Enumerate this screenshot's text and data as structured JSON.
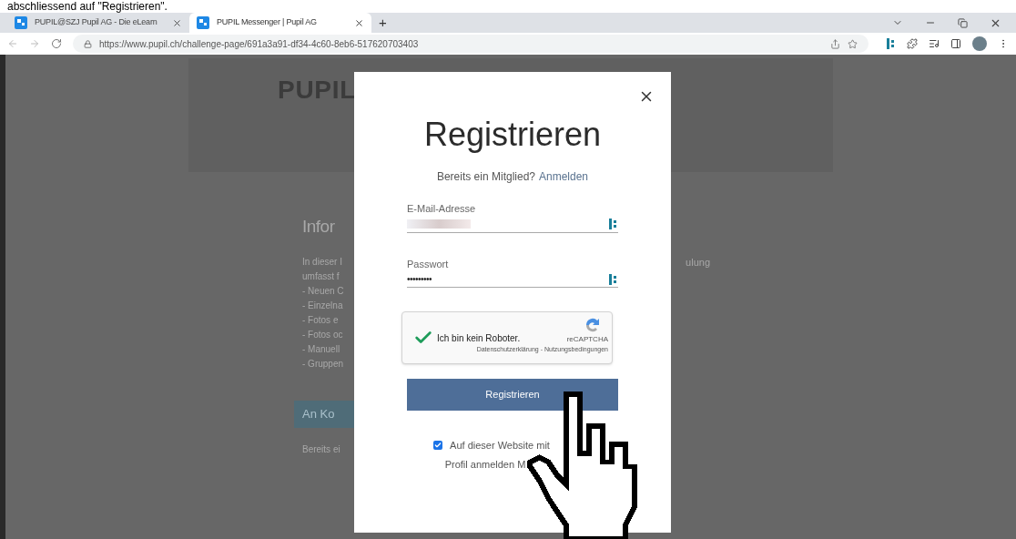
{
  "caption": "abschliessend auf \"Registrieren\".",
  "browser": {
    "tabs": [
      {
        "title": "PUPIL@SZJ Pupil AG - Die eLearn",
        "selected": false
      },
      {
        "title": "PUPIL Messenger | Pupil AG",
        "selected": true
      }
    ],
    "new_tab": "+",
    "url": "https://www.pupil.ch/challenge-page/691a3a91-df34-4c60-8eb6-517620703403"
  },
  "background_page": {
    "logo": "PUPIL",
    "heading": "Infor",
    "fragment_right": "ulung",
    "lines": [
      "In dieser I",
      "umfasst f",
      "- Neuen C",
      "- Einzelna",
      "- Fotos e",
      "- Fotos oc",
      "- Manuell",
      "- Gruppen"
    ],
    "button": "An Ko",
    "footer": "Bereits ei"
  },
  "modal": {
    "title": "Registrieren",
    "prompt": "Bereits ein Mitglied?",
    "link": "Anmelden",
    "fields": [
      {
        "kind": "email",
        "label": "E-Mail-Adresse"
      },
      {
        "kind": "password",
        "label": "Passwort",
        "value": "•••••••••"
      }
    ],
    "captcha": {
      "checked": true,
      "label": "Ich bin kein Roboter.",
      "brand": "reCAPTCHA",
      "links": "Datenschutzerklärung - Nutzungsbedingungen"
    },
    "submit": "Registrieren",
    "remember": {
      "checked": true,
      "line1": "Auf dieser Website mit",
      "line2": "Profil anmelden M"
    }
  }
}
